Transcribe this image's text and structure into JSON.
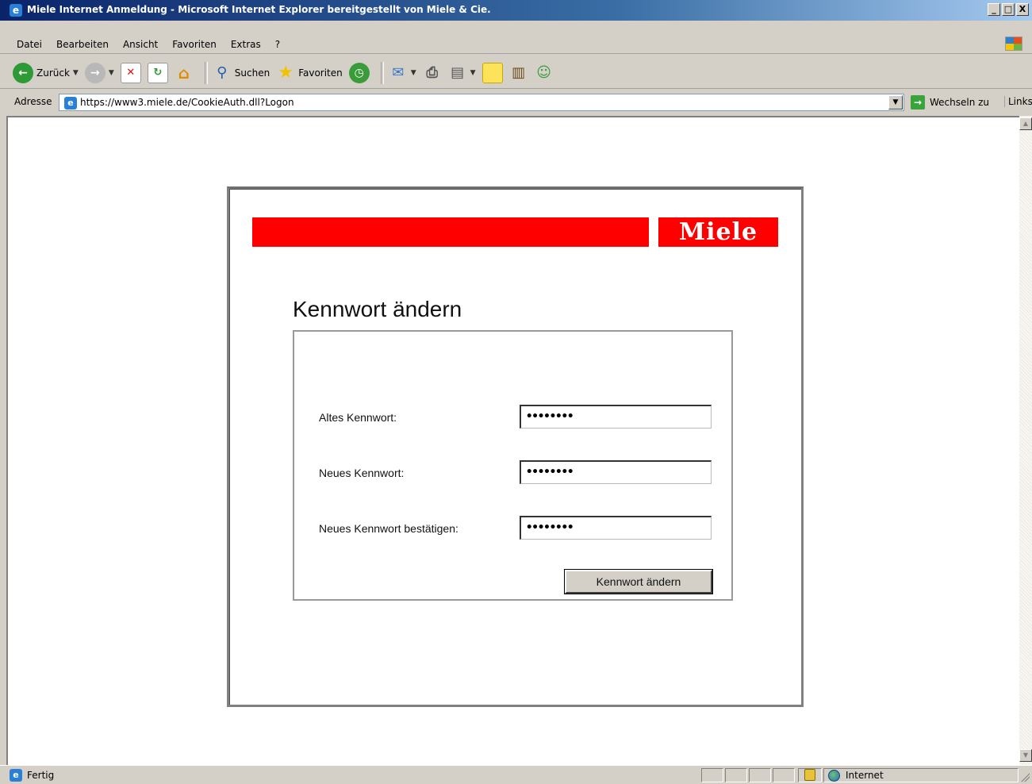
{
  "window": {
    "title": "Miele Internet Anmeldung - Microsoft Internet Explorer bereitgestellt von Miele & Cie.",
    "controls": {
      "minimize": "_",
      "maximize": "□",
      "close": "X"
    }
  },
  "menu": {
    "items": [
      "Datei",
      "Bearbeiten",
      "Ansicht",
      "Favoriten",
      "Extras",
      "?"
    ]
  },
  "toolbar": {
    "back_label": "Zurück",
    "search_label": "Suchen",
    "favorites_label": "Favoriten"
  },
  "address": {
    "label": "Adresse",
    "url": "https://www3.miele.de/CookieAuth.dll?Logon",
    "go_label": "Wechseln zu",
    "links_label": "Links"
  },
  "page": {
    "logo_text": "Miele",
    "heading": "Kennwort ändern",
    "form": {
      "old_password_label": "Altes Kennwort:",
      "old_password_value": "••••••••",
      "new_password_label": "Neues Kennwort:",
      "new_password_value": "••••••••",
      "confirm_password_label": "Neues Kennwort bestätigen:",
      "confirm_password_value": "••••••••",
      "submit_label": "Kennwort ändern"
    },
    "colors": {
      "brand_red": "#ff0000"
    }
  },
  "status": {
    "text": "Fertig",
    "zone": "Internet"
  }
}
